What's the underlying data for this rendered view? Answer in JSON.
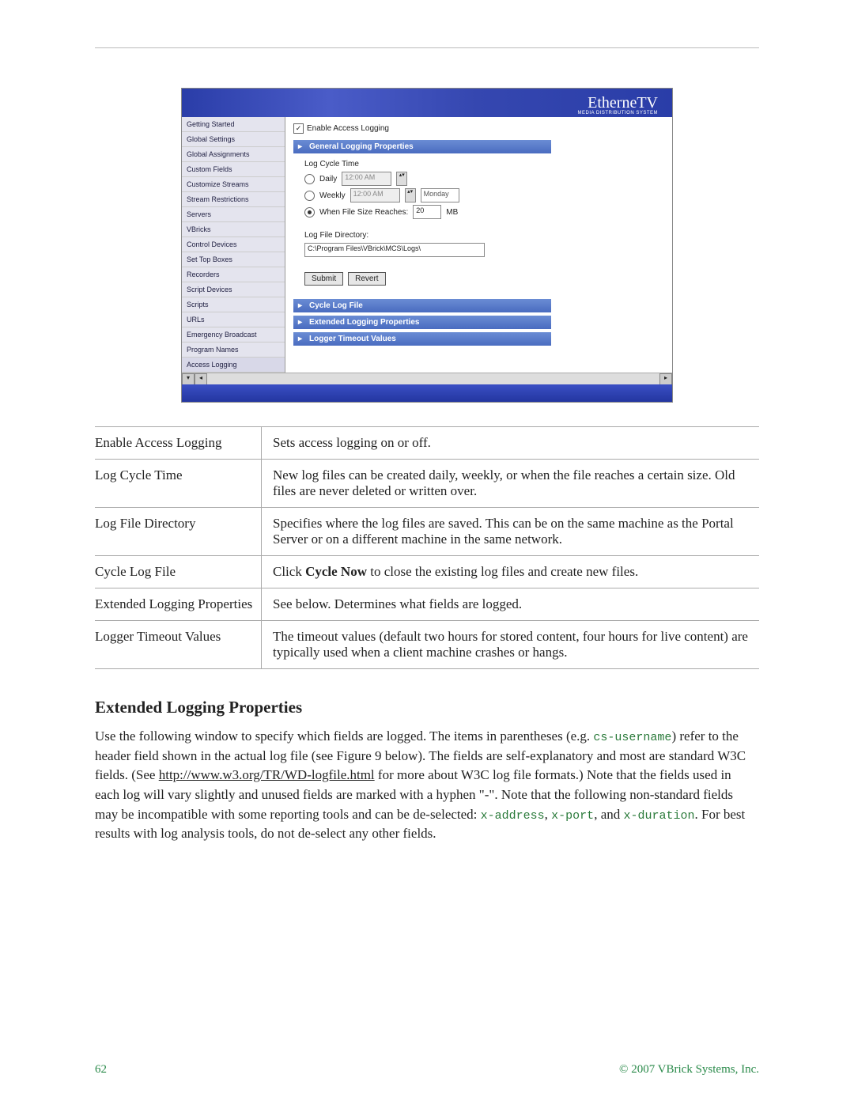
{
  "screenshot": {
    "logo": "EtherneTV",
    "logo_sub": "MEDIA DISTRIBUTION SYSTEM",
    "sidebar": [
      "Getting Started",
      "Global Settings",
      "Global Assignments",
      "Custom Fields",
      "Customize Streams",
      "Stream Restrictions",
      "Servers",
      "VBricks",
      "Control Devices",
      "Set Top Boxes",
      "Recorders",
      "Script Devices",
      "Scripts",
      "URLs",
      "Emergency Broadcast",
      "Program Names",
      "Access Logging"
    ],
    "checkbox_label": "Enable Access Logging",
    "section_general": "General Logging Properties",
    "log_cycle_time_label": "Log Cycle Time",
    "daily_label": "Daily",
    "daily_time": "12:00 AM",
    "weekly_label": "Weekly",
    "weekly_time": "12:00 AM",
    "weekly_day": "Monday",
    "filesize_label": "When File Size Reaches:",
    "filesize_value": "20",
    "filesize_unit": "MB",
    "log_dir_label": "Log File Directory:",
    "log_dir_value": "C:\\Program Files\\VBrick\\MCS\\Logs\\",
    "submit_btn": "Submit",
    "revert_btn": "Revert",
    "section_cycle": "Cycle Log File",
    "section_extended": "Extended Logging Properties",
    "section_timeout": "Logger Timeout Values"
  },
  "table": {
    "rows": [
      {
        "term": "Enable Access Logging",
        "desc": "Sets access logging on or off."
      },
      {
        "term": "Log Cycle Time",
        "desc": "New log files can be created daily, weekly, or when the file reaches a certain size. Old files are never deleted or written over."
      },
      {
        "term": "Log File Directory",
        "desc": "Specifies where the log files are saved. This can be on the same machine as the Portal Server or on a different machine in the same network."
      },
      {
        "term": "Cycle Log File",
        "desc_pre": "Click ",
        "desc_bold": "Cycle Now",
        "desc_post": " to close the existing log files and create new files."
      },
      {
        "term": "Extended Logging Properties",
        "desc": "See below. Determines what fields are logged."
      },
      {
        "term": "Logger Timeout Values",
        "desc": "The timeout values (default two hours for stored content, four hours for live content) are typically used when a client machine crashes or hangs."
      }
    ]
  },
  "heading": "Extended Logging Properties",
  "paragraph": {
    "p1": "Use the following window to specify which fields are logged. The items in parentheses (e.g. ",
    "code1": "cs-username",
    "p2": ") refer to the header field shown in the actual log file (see Figure 9 below). The fields are self-explanatory and most are standard W3C fields. (See ",
    "link": "http://www.w3.org/TR/WD-logfile.html",
    "p3": " for more about W3C log file formats.) Note that the fields used in each log will vary slightly and unused fields are marked with a hyphen \"-\". Note that the following non-standard fields may be incompatible with some reporting tools and can be de-selected: ",
    "code2": "x-address",
    "p4": ", ",
    "code3": "x-port",
    "p5": ", and ",
    "code4": "x-duration",
    "p6": ". For best results with log analysis tools, do not de-select any other fields."
  },
  "footer": {
    "page": "62",
    "copyright": "© 2007 VBrick Systems, Inc."
  }
}
